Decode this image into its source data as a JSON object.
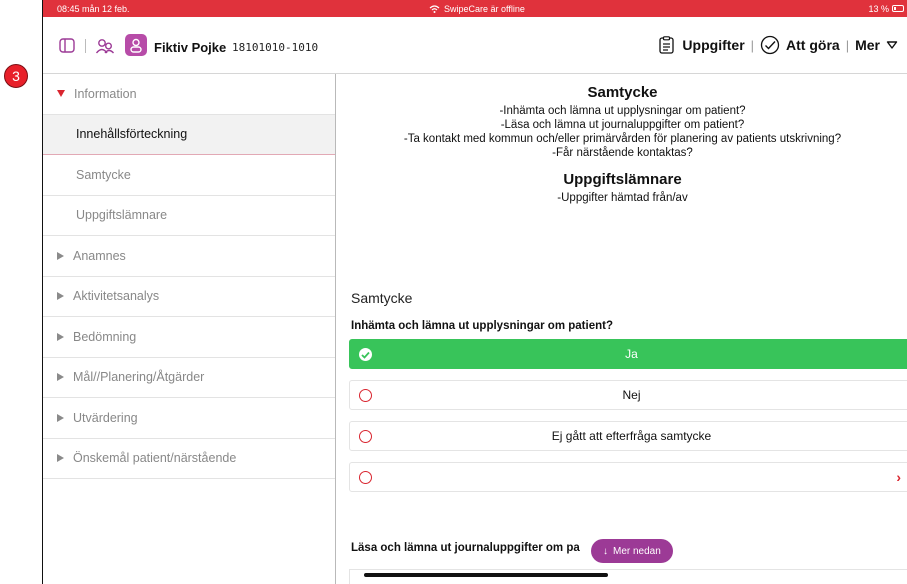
{
  "statusbar": {
    "time": "08:45  mån 12 feb.",
    "center": "SwipeCare är offline",
    "battery": "13 %"
  },
  "header": {
    "patient_name": "Fiktiv Pojke",
    "patient_id": "18101010-1010",
    "nav_tasks": "Uppgifter",
    "nav_todo": "Att göra",
    "nav_more": "Mer",
    "divider": "|"
  },
  "badge": {
    "number": "3"
  },
  "sidebar": {
    "items": [
      {
        "label": "Information",
        "kind": "top",
        "expanded": true
      },
      {
        "label": "Innehållsförteckning",
        "kind": "sub",
        "active": true
      },
      {
        "label": "Samtycke",
        "kind": "sub"
      },
      {
        "label": "Uppgiftslämnare",
        "kind": "sub"
      },
      {
        "label": "Anamnes",
        "kind": "top"
      },
      {
        "label": "Aktivitetsanalys",
        "kind": "top"
      },
      {
        "label": "Bedömning",
        "kind": "top"
      },
      {
        "label": "Mål//Planering/Åtgärder",
        "kind": "top"
      },
      {
        "label": "Utvärdering",
        "kind": "top"
      },
      {
        "label": "Önskemål patient/närstående",
        "kind": "top"
      }
    ]
  },
  "main": {
    "toc": {
      "heading1": "Samtycke",
      "lines1": [
        "-Inhämta och lämna ut upplysningar om patient?",
        "-Läsa och lämna ut journaluppgifter om patient?",
        "-Ta kontakt med kommun och/eller primärvården för planering av patients utskrivning?",
        "-Får närstående kontaktas?"
      ],
      "heading2": "Uppgiftslämnare",
      "lines2": [
        "-Uppgifter hämtad från/av"
      ]
    },
    "section_title": "Samtycke",
    "question1": "Inhämta och lämna ut upplysningar om patient?",
    "options": [
      "Ja",
      "Nej",
      "Ej gått att efterfråga samtycke",
      ""
    ],
    "selected_option": "Ja",
    "question2": "Läsa och lämna ut journaluppgifter om pa",
    "more_button": "Mer nedan"
  },
  "colors": {
    "accent_red": "#d9252f",
    "status_red": "#e0323c",
    "selected_green": "#38c45a",
    "purple": "#9c3a96"
  }
}
